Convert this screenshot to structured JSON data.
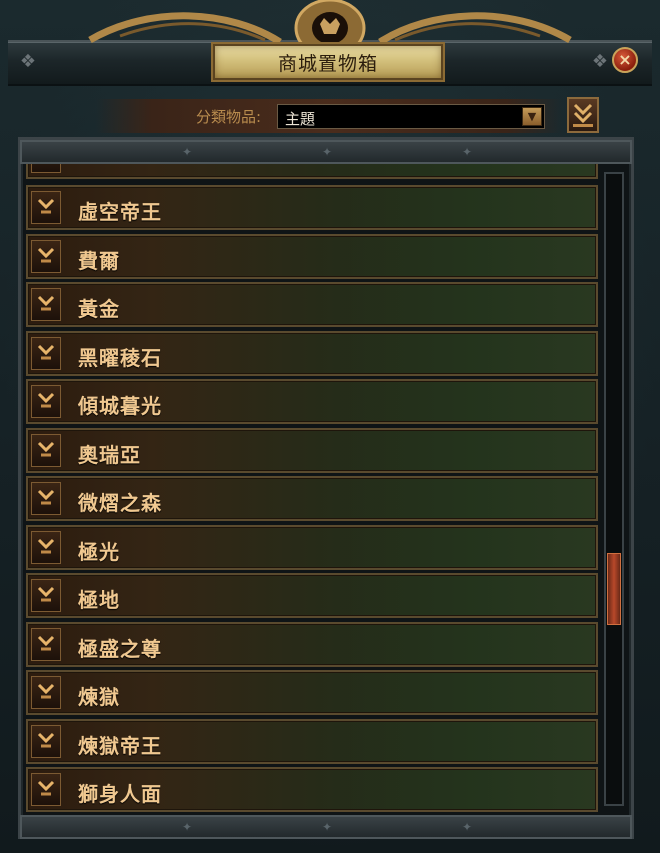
{
  "window": {
    "title": "商城置物箱",
    "close_symbol": "×"
  },
  "filter": {
    "label": "分類物品:",
    "selected": "主題",
    "dropdown_arrow": "▼"
  },
  "items": [
    {
      "label": ""
    },
    {
      "label": "虛空帝王"
    },
    {
      "label": "費爾"
    },
    {
      "label": "黃金"
    },
    {
      "label": "黑曜稜石"
    },
    {
      "label": "傾城暮光"
    },
    {
      "label": "奧瑞亞"
    },
    {
      "label": "微熠之森"
    },
    {
      "label": "極光"
    },
    {
      "label": "極地"
    },
    {
      "label": "極盛之尊"
    },
    {
      "label": "煉獄"
    },
    {
      "label": "煉獄帝王"
    },
    {
      "label": "獅身人面"
    }
  ],
  "scroll": {
    "position_fraction": 0.68
  },
  "icons": {
    "list_item_icon": "chevron-down-icon",
    "collapse_button_icon": "chevron-down-icon",
    "header_emblem": "lion-emblem-icon",
    "close": "close-icon"
  },
  "colors": {
    "title_plate": "#d3c07c",
    "item_text": "#f0c890",
    "label_text": "#b98c4e",
    "scroll_thumb": "#b8482a"
  }
}
